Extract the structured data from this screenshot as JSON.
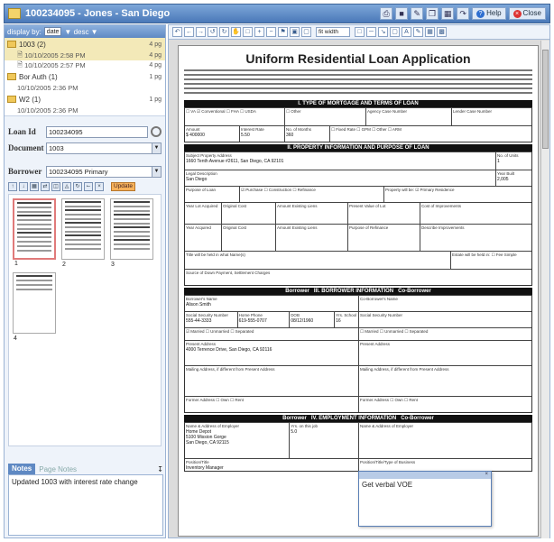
{
  "window": {
    "title": "100234095 - Jones - San Diego",
    "help": "Help",
    "close": "Close"
  },
  "left": {
    "display_by_label": "display by:",
    "display_by_value": "date",
    "sort_label": "▼ desc ▼",
    "groups": [
      {
        "name": "1003 (2)",
        "count": "4 pg",
        "items": [
          {
            "date": "10/10/2005 2:58 PM",
            "count": "4 pg"
          },
          {
            "date": "10/10/2005 2:57 PM",
            "count": "4 pg"
          }
        ]
      },
      {
        "name": "Bor Auth (1)",
        "count": "1 pg",
        "items": [
          {
            "date": "10/10/2005 2:36 PM",
            "count": ""
          }
        ]
      },
      {
        "name": "W2 (1)",
        "count": "1 pg",
        "items": [
          {
            "date": "10/10/2005 2:36 PM",
            "count": ""
          }
        ]
      }
    ],
    "loan_label": "Loan Id",
    "loan_value": "100234095",
    "document_label": "Document",
    "document_value": "1003",
    "borrower_label": "Borrower",
    "borrower_value": "100234095 Primary",
    "update_label": "Update",
    "thumbnails": [
      "1",
      "2",
      "3",
      "4"
    ],
    "notes_tab": "Notes",
    "page_notes_tab": "Page Notes",
    "notes_text": "Updated 1003 with interest rate change"
  },
  "viewer": {
    "zoom": "fit width",
    "form_title": "Uniform Residential Loan Application",
    "sections": [
      "I. TYPE OF MORTGAGE AND TERMS OF LOAN",
      "II. PROPERTY INFORMATION AND PURPOSE OF LOAN",
      "III. BORROWER INFORMATION",
      "IV. EMPLOYMENT INFORMATION"
    ],
    "borrower_col": "Borrower",
    "coborrower_col": "Co-Borrower",
    "amount": "$ 400000",
    "rate": "5.50",
    "months": "360",
    "address": "1660 Tenth Avenue #2611, San Diego, CA 92101",
    "county": "San Diego",
    "units": "1",
    "year_built": "2,005",
    "borrower_name": "Alison Smith",
    "ssn": "555-44-3333",
    "phone": "619-555-0707",
    "dob": "08/12/1960",
    "yrs_school": "16",
    "present_address": "4000 Terrence Drive, San Diego, CA 92116",
    "employer": "Home Depot\n5100 Mission Gorge\nSan Diego, CA 92115",
    "yrs_job": "5.0",
    "position": "Inventory Manager",
    "popup_text": "Get verbal VOE"
  },
  "colors": {
    "accent": "#5f89c3",
    "selected": "#f3e9b8",
    "highlight": "#e07a7a"
  }
}
